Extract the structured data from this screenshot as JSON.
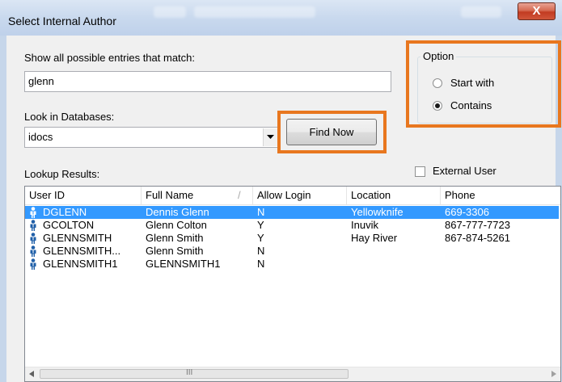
{
  "window": {
    "title": "Select Internal Author",
    "close_glyph": "X"
  },
  "search": {
    "label": "Show all possible entries that match:",
    "value": "glenn"
  },
  "database": {
    "label": "Look in Databases:",
    "value": "idocs"
  },
  "find_button": {
    "label": "Find Now"
  },
  "option": {
    "legend": "Option",
    "start_with": "Start with",
    "contains": "Contains",
    "selected": "contains"
  },
  "external_user": {
    "label": "External User",
    "checked": false
  },
  "results": {
    "label": "Lookup Results:",
    "columns": [
      "User ID",
      "Full Name",
      "Allow Login",
      "Location",
      "Phone"
    ],
    "sort_indicator": "/",
    "rows": [
      {
        "user_id": "DGLENN",
        "full_name": "Dennis Glenn",
        "allow_login": "N",
        "location": "Yellowknife",
        "phone": "669-3306",
        "selected": true
      },
      {
        "user_id": "GCOLTON",
        "full_name": "Glenn Colton",
        "allow_login": "Y",
        "location": "Inuvik",
        "phone": "867-777-7723"
      },
      {
        "user_id": "GLENNSMITH",
        "full_name": "Glenn Smith",
        "allow_login": "Y",
        "location": "Hay River",
        "phone": "867-874-5261"
      },
      {
        "user_id": "GLENNSMITH...",
        "full_name": "Glenn Smith",
        "allow_login": "N",
        "location": "",
        "phone": ""
      },
      {
        "user_id": "GLENNSMITH1",
        "full_name": "GLENNSMITH1",
        "allow_login": "N",
        "location": "",
        "phone": ""
      }
    ]
  },
  "scrollbar": {
    "thumb_grip": "III"
  },
  "colors": {
    "highlight": "#e8771f",
    "selection": "#3399ff",
    "user_icon": "#1f5fa8"
  }
}
